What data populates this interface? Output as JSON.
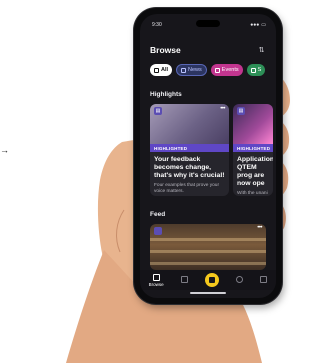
{
  "arrow": "→",
  "status": {
    "time": "9:30",
    "signal": "●●●",
    "battery": "▭"
  },
  "header": {
    "title": "Browse",
    "filter_icon": "⇅"
  },
  "chips": [
    {
      "label": "All"
    },
    {
      "label": "News"
    },
    {
      "label": "Events"
    },
    {
      "label": "S"
    }
  ],
  "highlights": {
    "label": "Highlights",
    "cards": [
      {
        "tag": "HIGHLIGHTED",
        "heading": "Your feedback becomes change, that's why it's crucial!",
        "sub": "Four examples that prove your voice matters."
      },
      {
        "tag": "HIGHLIGHTED",
        "heading": "Applications QTEM prog are now ope",
        "sub": "With the unani support of all"
      }
    ]
  },
  "feed": {
    "label": "Feed"
  },
  "tabbar": {
    "browse_label": "Browse"
  },
  "colors": {
    "accent_purple": "#5f47c6",
    "events_pink": "#c2358f",
    "center_yellow": "#f4c81d"
  }
}
